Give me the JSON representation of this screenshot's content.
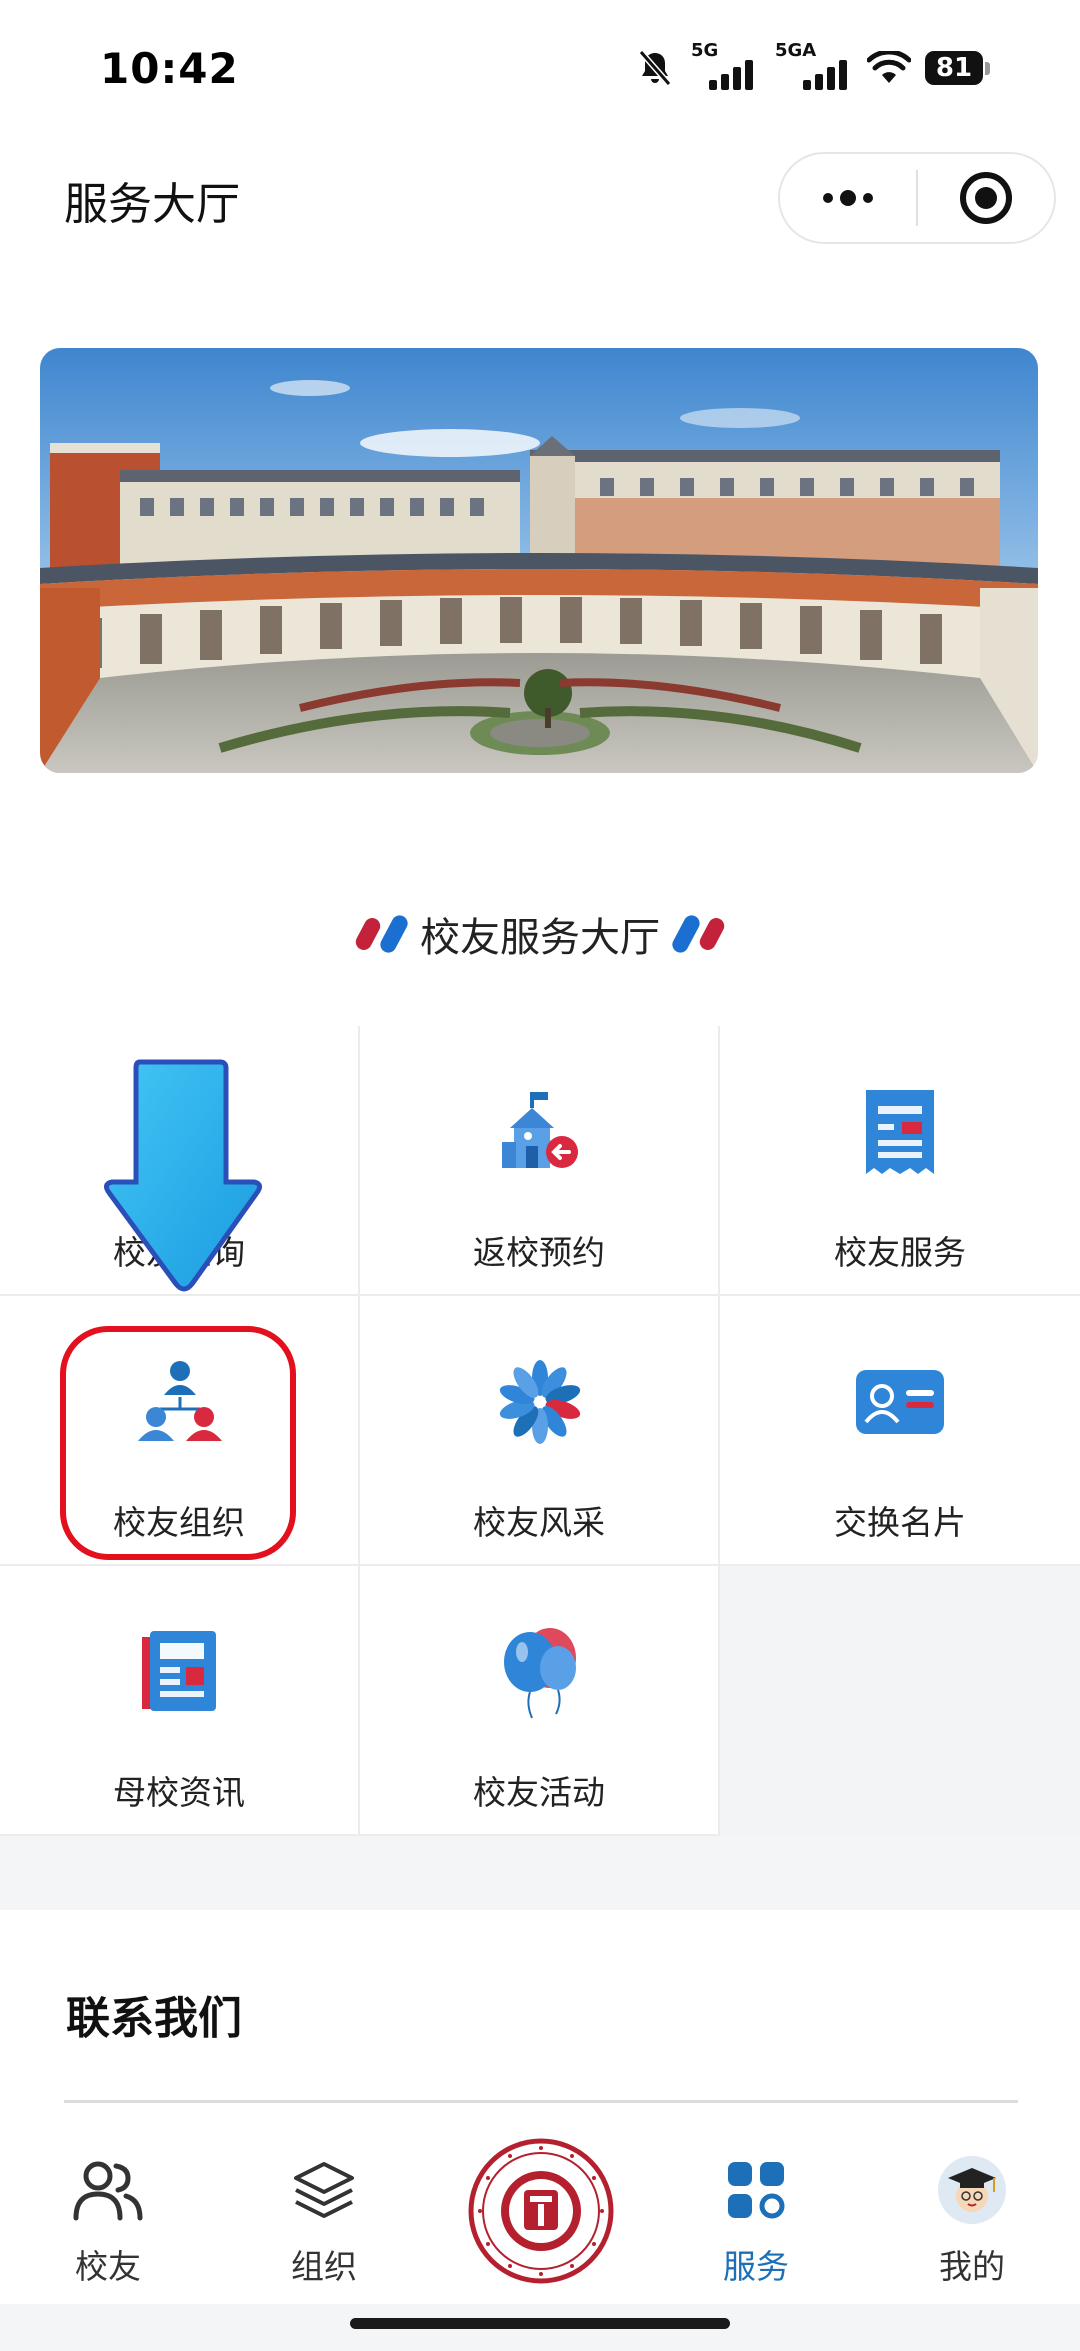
{
  "status_bar": {
    "time": "10:42",
    "network1": "5G",
    "network2": "5GA",
    "battery": "81"
  },
  "nav": {
    "title": "服务大厅",
    "more_icon": "more-dots-icon",
    "target_icon": "target-circle-icon"
  },
  "section": {
    "title": "校友服务大厅"
  },
  "services": [
    {
      "label": "校友查询",
      "icon": "search-person-icon"
    },
    {
      "label": "返校预约",
      "icon": "school-return-icon"
    },
    {
      "label": "校友服务",
      "icon": "receipt-icon"
    },
    {
      "label": "校友组织",
      "icon": "organization-icon"
    },
    {
      "label": "校友风采",
      "icon": "pinwheel-icon"
    },
    {
      "label": "交换名片",
      "icon": "business-card-icon"
    },
    {
      "label": "母校资讯",
      "icon": "newspaper-icon"
    },
    {
      "label": "校友活动",
      "icon": "balloons-icon"
    }
  ],
  "contact": {
    "title": "联系我们"
  },
  "tabs": [
    {
      "label": "校友",
      "icon": "people-icon",
      "active": false
    },
    {
      "label": "组织",
      "icon": "layers-icon",
      "active": false
    },
    {
      "label": "",
      "icon": "university-seal-logo",
      "active": false
    },
    {
      "label": "服务",
      "icon": "grid-apps-icon",
      "active": true
    },
    {
      "label": "我的",
      "icon": "avatar-graduate-icon",
      "active": false
    }
  ],
  "colors": {
    "accent_blue": "#1d6fb8",
    "accent_red": "#c4223a",
    "highlight": "#e3101e"
  }
}
